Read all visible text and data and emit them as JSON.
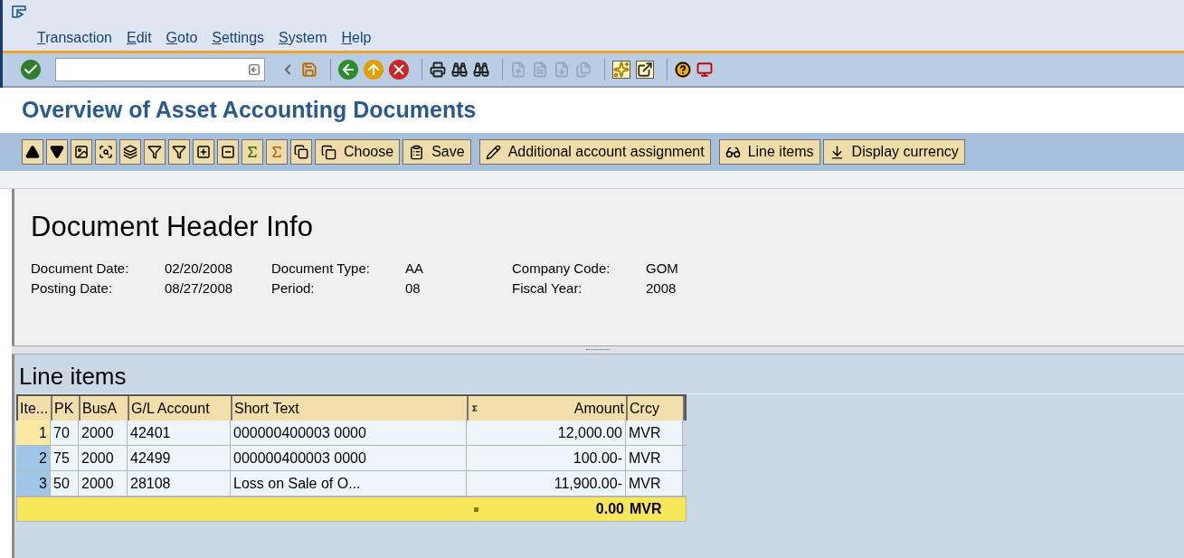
{
  "menu_bar": {
    "items": [
      "Transaction",
      "Edit",
      "Goto",
      "Settings",
      "System",
      "Help"
    ]
  },
  "standard_toolbar": {
    "buttons": [
      {
        "disabled": false
      },
      {
        "disabled": false
      },
      {
        "disabled": false
      },
      {
        "disabled": false
      },
      {
        "disabled": false
      },
      {
        "disabled": false
      },
      {
        "disabled": false
      },
      {
        "disabled": false
      },
      {
        "disabled": false
      },
      {
        "disabled": true
      },
      {
        "disabled": true
      },
      {
        "disabled": true
      },
      {
        "disabled": true
      },
      {
        "disabled": false
      },
      {
        "disabled": false
      },
      {
        "disabled": false
      },
      {
        "disabled": false
      }
    ]
  },
  "title": "Overview of Asset Accounting Documents",
  "application_toolbar": {
    "buttons": [
      {
        "label": "Choose"
      },
      {
        "label": "Save"
      },
      {
        "label": "Additional account assignment"
      },
      {
        "label": "Line items"
      },
      {
        "label": "Display currency"
      }
    ]
  },
  "header": {
    "title": "Document Header Info",
    "fields": [
      {
        "label": "Document Date:",
        "value": "02/20/2008"
      },
      {
        "label": "Document Type:",
        "value": "AA"
      },
      {
        "label": "Company Code:",
        "value": "GOM"
      },
      {
        "label": "Posting Date:",
        "value": "08/27/2008"
      },
      {
        "label": "Period:",
        "value": "08"
      },
      {
        "label": "Fiscal Year:",
        "value": "2008"
      }
    ]
  },
  "line_items": {
    "title": "Line items",
    "columns": [
      {
        "label": "Ite..."
      },
      {
        "label": "PK"
      },
      {
        "label": "BusA"
      },
      {
        "label": "G/L Account"
      },
      {
        "label": "Short Text"
      },
      {
        "label": "Amount"
      },
      {
        "label": "Crcy"
      }
    ],
    "rows": [
      {
        "selected": true,
        "cells": [
          "1",
          "70",
          "2000",
          "42401",
          "000000400003 0000",
          "12,000.00",
          "MVR"
        ]
      },
      {
        "selected": false,
        "cells": [
          "2",
          "75",
          "2000",
          "42499",
          "000000400003 0000",
          "100.00-",
          "MVR"
        ]
      },
      {
        "selected": false,
        "cells": [
          "3",
          "50",
          "2000",
          "28108",
          "Loss on Sale of O...",
          "11,900.00-",
          "MVR"
        ]
      }
    ],
    "total_row": {
      "amount": "0.00",
      "currency": "MVR"
    }
  }
}
